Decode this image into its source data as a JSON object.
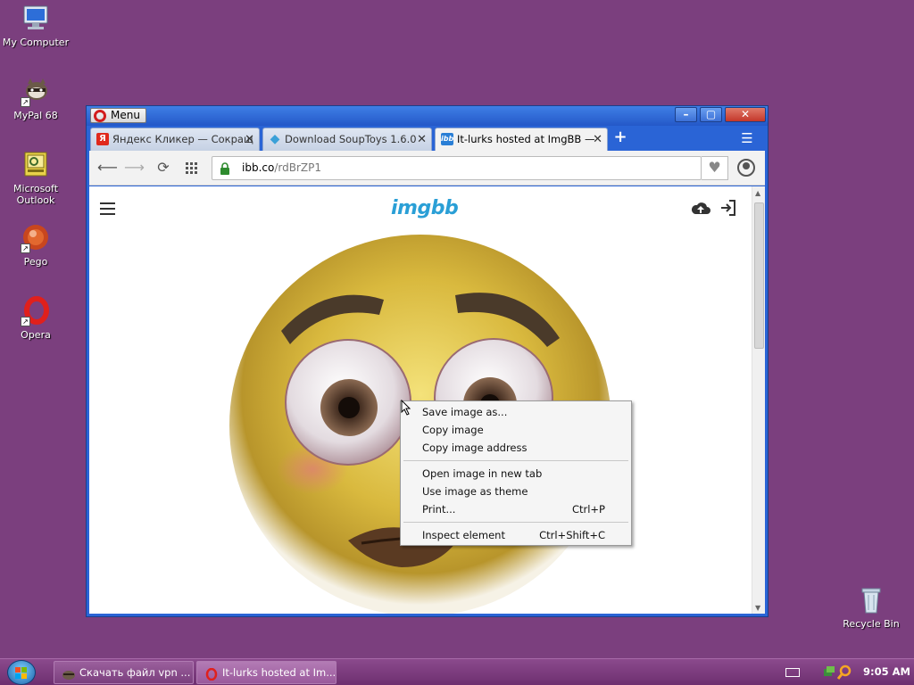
{
  "desktop": {
    "icons": [
      {
        "label": "My Computer",
        "icon": "computer-icon"
      },
      {
        "label": "MyPal 68",
        "icon": "raccoon-icon"
      },
      {
        "label": "Microsoft Outlook",
        "icon": "outlook-icon"
      },
      {
        "label": "Pego",
        "icon": "pego-icon"
      },
      {
        "label": "Opera",
        "icon": "opera-icon"
      },
      {
        "label": "Recycle Bin",
        "icon": "recycle-bin-icon"
      }
    ],
    "background_color": "#7b3f7e"
  },
  "browser": {
    "menu_label": "Menu",
    "window_controls": {
      "minimize": "–",
      "maximize": "▢",
      "close": "✕"
    },
    "tabs": [
      {
        "title": "Яндекс Кликер — Сокращ",
        "favicon": "Я",
        "favicon_color": "#e0291c",
        "active": false
      },
      {
        "title": "Download SoupToys 1.6.0",
        "favicon": "◆",
        "favicon_color": "#3aa0d8",
        "active": false
      },
      {
        "title": "It-lurks hosted at ImgBB —",
        "favicon": "ibb",
        "favicon_color": "#2a7fd6",
        "active": true
      }
    ],
    "new_tab": "+",
    "address": {
      "host": "ibb.co",
      "path": "/rdBrZP1"
    }
  },
  "page": {
    "logo": "imgbb"
  },
  "context_menu": {
    "groups": [
      [
        {
          "label": "Save image as...",
          "shortcut": ""
        },
        {
          "label": "Copy image",
          "shortcut": ""
        },
        {
          "label": "Copy image address",
          "shortcut": ""
        }
      ],
      [
        {
          "label": "Open image in new tab",
          "shortcut": ""
        },
        {
          "label": "Use image as theme",
          "shortcut": ""
        },
        {
          "label": "Print...",
          "shortcut": "Ctrl+P"
        }
      ],
      [
        {
          "label": "Inspect element",
          "shortcut": "Ctrl+Shift+C"
        }
      ]
    ]
  },
  "taskbar": {
    "tasks": [
      {
        "label": "Скачать файл vpn ...",
        "icon": "raccoon-icon",
        "active": false
      },
      {
        "label": "It-lurks hosted at Im...",
        "icon": "opera-icon",
        "active": true
      }
    ],
    "clock": "9:05 AM"
  }
}
